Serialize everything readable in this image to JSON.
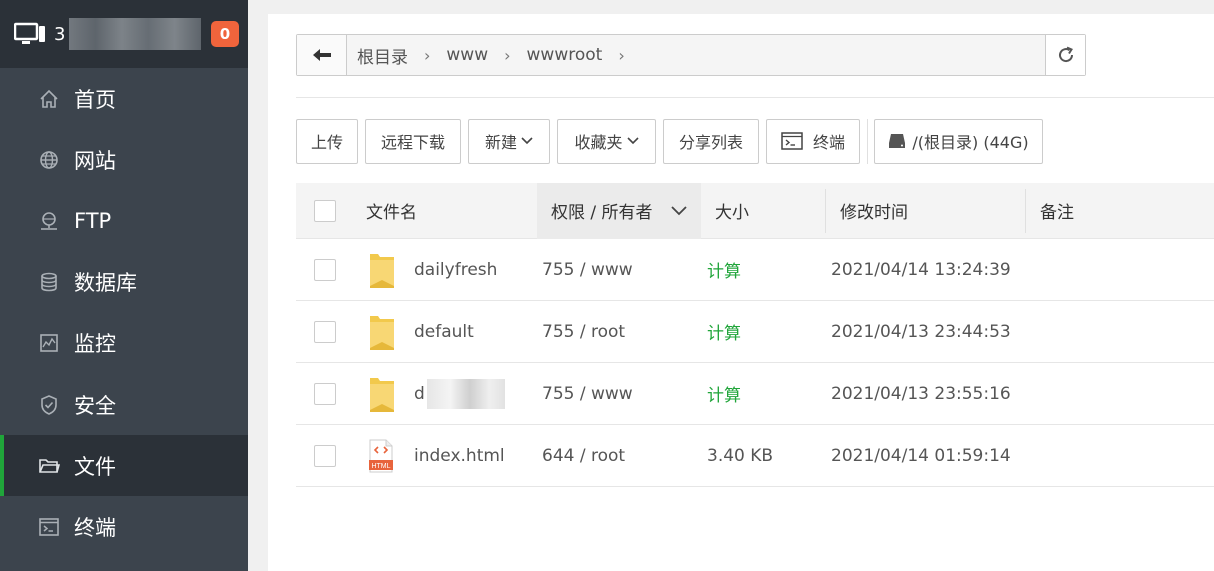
{
  "sidebar": {
    "server_prefix": "3",
    "badge_count": "0",
    "items": [
      {
        "label": "首页",
        "icon": "home-icon"
      },
      {
        "label": "网站",
        "icon": "globe-icon"
      },
      {
        "label": "FTP",
        "icon": "ftp-icon"
      },
      {
        "label": "数据库",
        "icon": "database-icon"
      },
      {
        "label": "监控",
        "icon": "monitor-chart-icon"
      },
      {
        "label": "安全",
        "icon": "shield-icon"
      },
      {
        "label": "文件",
        "icon": "folder-icon",
        "active": true
      },
      {
        "label": "终端",
        "icon": "terminal-icon"
      }
    ]
  },
  "path": {
    "crumbs": [
      "根目录",
      "www",
      "wwwroot"
    ]
  },
  "toolbar": {
    "upload": "上传",
    "remote_download": "远程下载",
    "new": "新建",
    "favorites": "收藏夹",
    "share_list": "分享列表",
    "terminal": "终端",
    "disk": "/(根目录) (44G)"
  },
  "table": {
    "headers": {
      "name": "文件名",
      "perm": "权限 / 所有者",
      "size": "大小",
      "mtime": "修改时间",
      "note": "备注"
    },
    "rows": [
      {
        "name": "dailyfresh",
        "type": "folder",
        "perm": "755 / www",
        "size": "计算",
        "mtime": "2021/04/14 13:24:39"
      },
      {
        "name": "default",
        "type": "folder",
        "perm": "755 / root",
        "size": "计算",
        "mtime": "2021/04/13 23:44:53"
      },
      {
        "name": "d",
        "type": "folder",
        "perm": "755 / www",
        "size": "计算",
        "mtime": "2021/04/13 23:55:16"
      },
      {
        "name": "index.html",
        "type": "html",
        "perm": "644 / root",
        "size": "3.40 KB",
        "mtime": "2021/04/14 01:59:14"
      }
    ]
  },
  "colors": {
    "sidebar_bg": "#3c444d",
    "accent_green": "#20a53a",
    "badge_orange": "#f0643c"
  }
}
